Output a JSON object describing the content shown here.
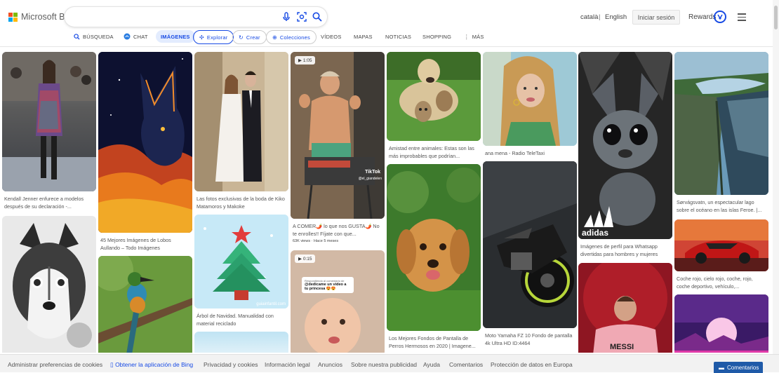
{
  "header": {
    "logo_text": "Microsoft Bing",
    "search_value": "",
    "lang_ca": "català",
    "lang_sep": "|",
    "lang_en": "English",
    "signin_label": "Iniciar sesión",
    "rewards_label": "Rewards"
  },
  "nav": {
    "busqueda": "BÚSQUEDA",
    "chat": "CHAT",
    "imagenes": "IMÁGENES",
    "explorar": "Explorar",
    "crear": "Crear",
    "colecciones": "Colecciones",
    "videos": "VÍDEOS",
    "mapas": "MAPAS",
    "noticias": "NOTICIAS",
    "shopping": "SHOPPING",
    "mas": "MÁS"
  },
  "results": [
    {
      "caption": "Kendall Jenner enfurece a modelos después de su declaración -..."
    },
    {
      "caption": ""
    },
    {
      "caption": "45 Mejores Imágenes de Lobos Aullando – Todo Imágenes"
    },
    {
      "caption": ""
    },
    {
      "caption": "Las fotos exclusivas de la boda de Kiko Matamoros y Makoke"
    },
    {
      "caption": "Árbol de Navidad. Manualidad con material reciclado",
      "watermark": "guiainfantil.com"
    },
    {
      "caption": ""
    },
    {
      "caption": "A COMER🌶️ lo que nos GUSTA🌶️ No te enrolles!! Fíjate con que...",
      "duration": "1:05",
      "meta": "63K views · Hace 5 meses",
      "logo": "TikTok",
      "handle": "@el_giandelen"
    },
    {
      "caption": "",
      "duration": "0:15",
      "overlay_small": "Respondiendo al comentario de",
      "overlay_text": "@dedicame un video a tu princesa 😍😍"
    },
    {
      "caption": "Amistad entre animales: Estas son las más improbables que podrían..."
    },
    {
      "caption": "Los Mejores Fondos de Pantalla de Perros Hermosos en 2020 | Imagene..."
    },
    {
      "caption": "ana mena - Radio TeleTaxi"
    },
    {
      "caption": "Moto Yamaha FZ 10 Fondo de pantalla 4k Ultra HD ID:4464"
    },
    {
      "caption": "Imágenes de perfil para Whatsapp divertidas para hombres y mujeres",
      "logo": "adidas"
    },
    {
      "caption": "",
      "jersey": "MESSI"
    },
    {
      "caption": "Sørvágsvatn, un espectacular lago sobre el océano en las islas Feroe. |..."
    },
    {
      "caption": "Coche rojo, cielo rojo, coche, rojo, coche deportivo, vehículo,..."
    },
    {
      "caption": ""
    }
  ],
  "footer": {
    "cookies": "Administrar preferencias de cookies",
    "app": "Obtener la aplicación de Bing",
    "privacy": "Privacidad y cookies",
    "legal": "Información legal",
    "ads": "Anuncios",
    "about_ads": "Sobre nuestra publicidad",
    "help": "Ayuda",
    "comments": "Comentarios",
    "data_protection": "Protección de datos en Europa",
    "feedback_button": "Comentarios"
  },
  "colors": {
    "accent": "#174ae4",
    "footer_bg": "#f2f2f2"
  }
}
